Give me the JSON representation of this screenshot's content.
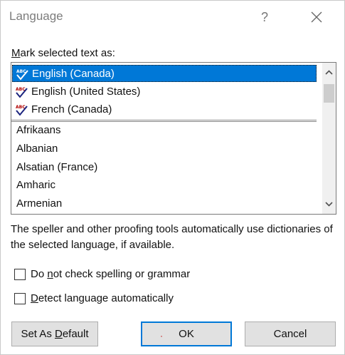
{
  "dialog": {
    "title": "Language",
    "help_glyph": "?",
    "close_icon": "close-icon"
  },
  "list_section": {
    "label_mnemonic": "M",
    "label_rest": "ark selected text as:",
    "preferred_languages": [
      {
        "label": "English (Canada)",
        "selected": true,
        "icon": "spelling-check-icon"
      },
      {
        "label": "English (United States)",
        "selected": false,
        "icon": "spelling-check-icon"
      },
      {
        "label": "French (Canada)",
        "selected": false,
        "icon": "spelling-check-icon"
      }
    ],
    "other_languages": [
      {
        "label": "Afrikaans"
      },
      {
        "label": "Albanian"
      },
      {
        "label": "Alsatian (France)"
      },
      {
        "label": "Amharic"
      },
      {
        "label": "Armenian"
      }
    ]
  },
  "description": "The speller and other proofing tools automatically use dictionaries of the selected language, if available.",
  "options": {
    "no_check": {
      "pre": "Do ",
      "mnemonic": "n",
      "post": "ot check spelling or grammar",
      "checked": false
    },
    "detect": {
      "pre": "",
      "mnemonic": "D",
      "post": "etect language automatically",
      "checked": false
    }
  },
  "buttons": {
    "set_default": {
      "pre": "Set As ",
      "mnemonic": "D",
      "post": "efault"
    },
    "ok": {
      "label": "OK",
      "marker": "·"
    },
    "cancel": {
      "label": "Cancel"
    }
  },
  "colors": {
    "selection": "#0078d7",
    "button_face": "#e1e1e1",
    "default_button_border": "#0078d7",
    "spell_icon_check": "#1a237e",
    "spell_icon_letters": "#b00000"
  }
}
